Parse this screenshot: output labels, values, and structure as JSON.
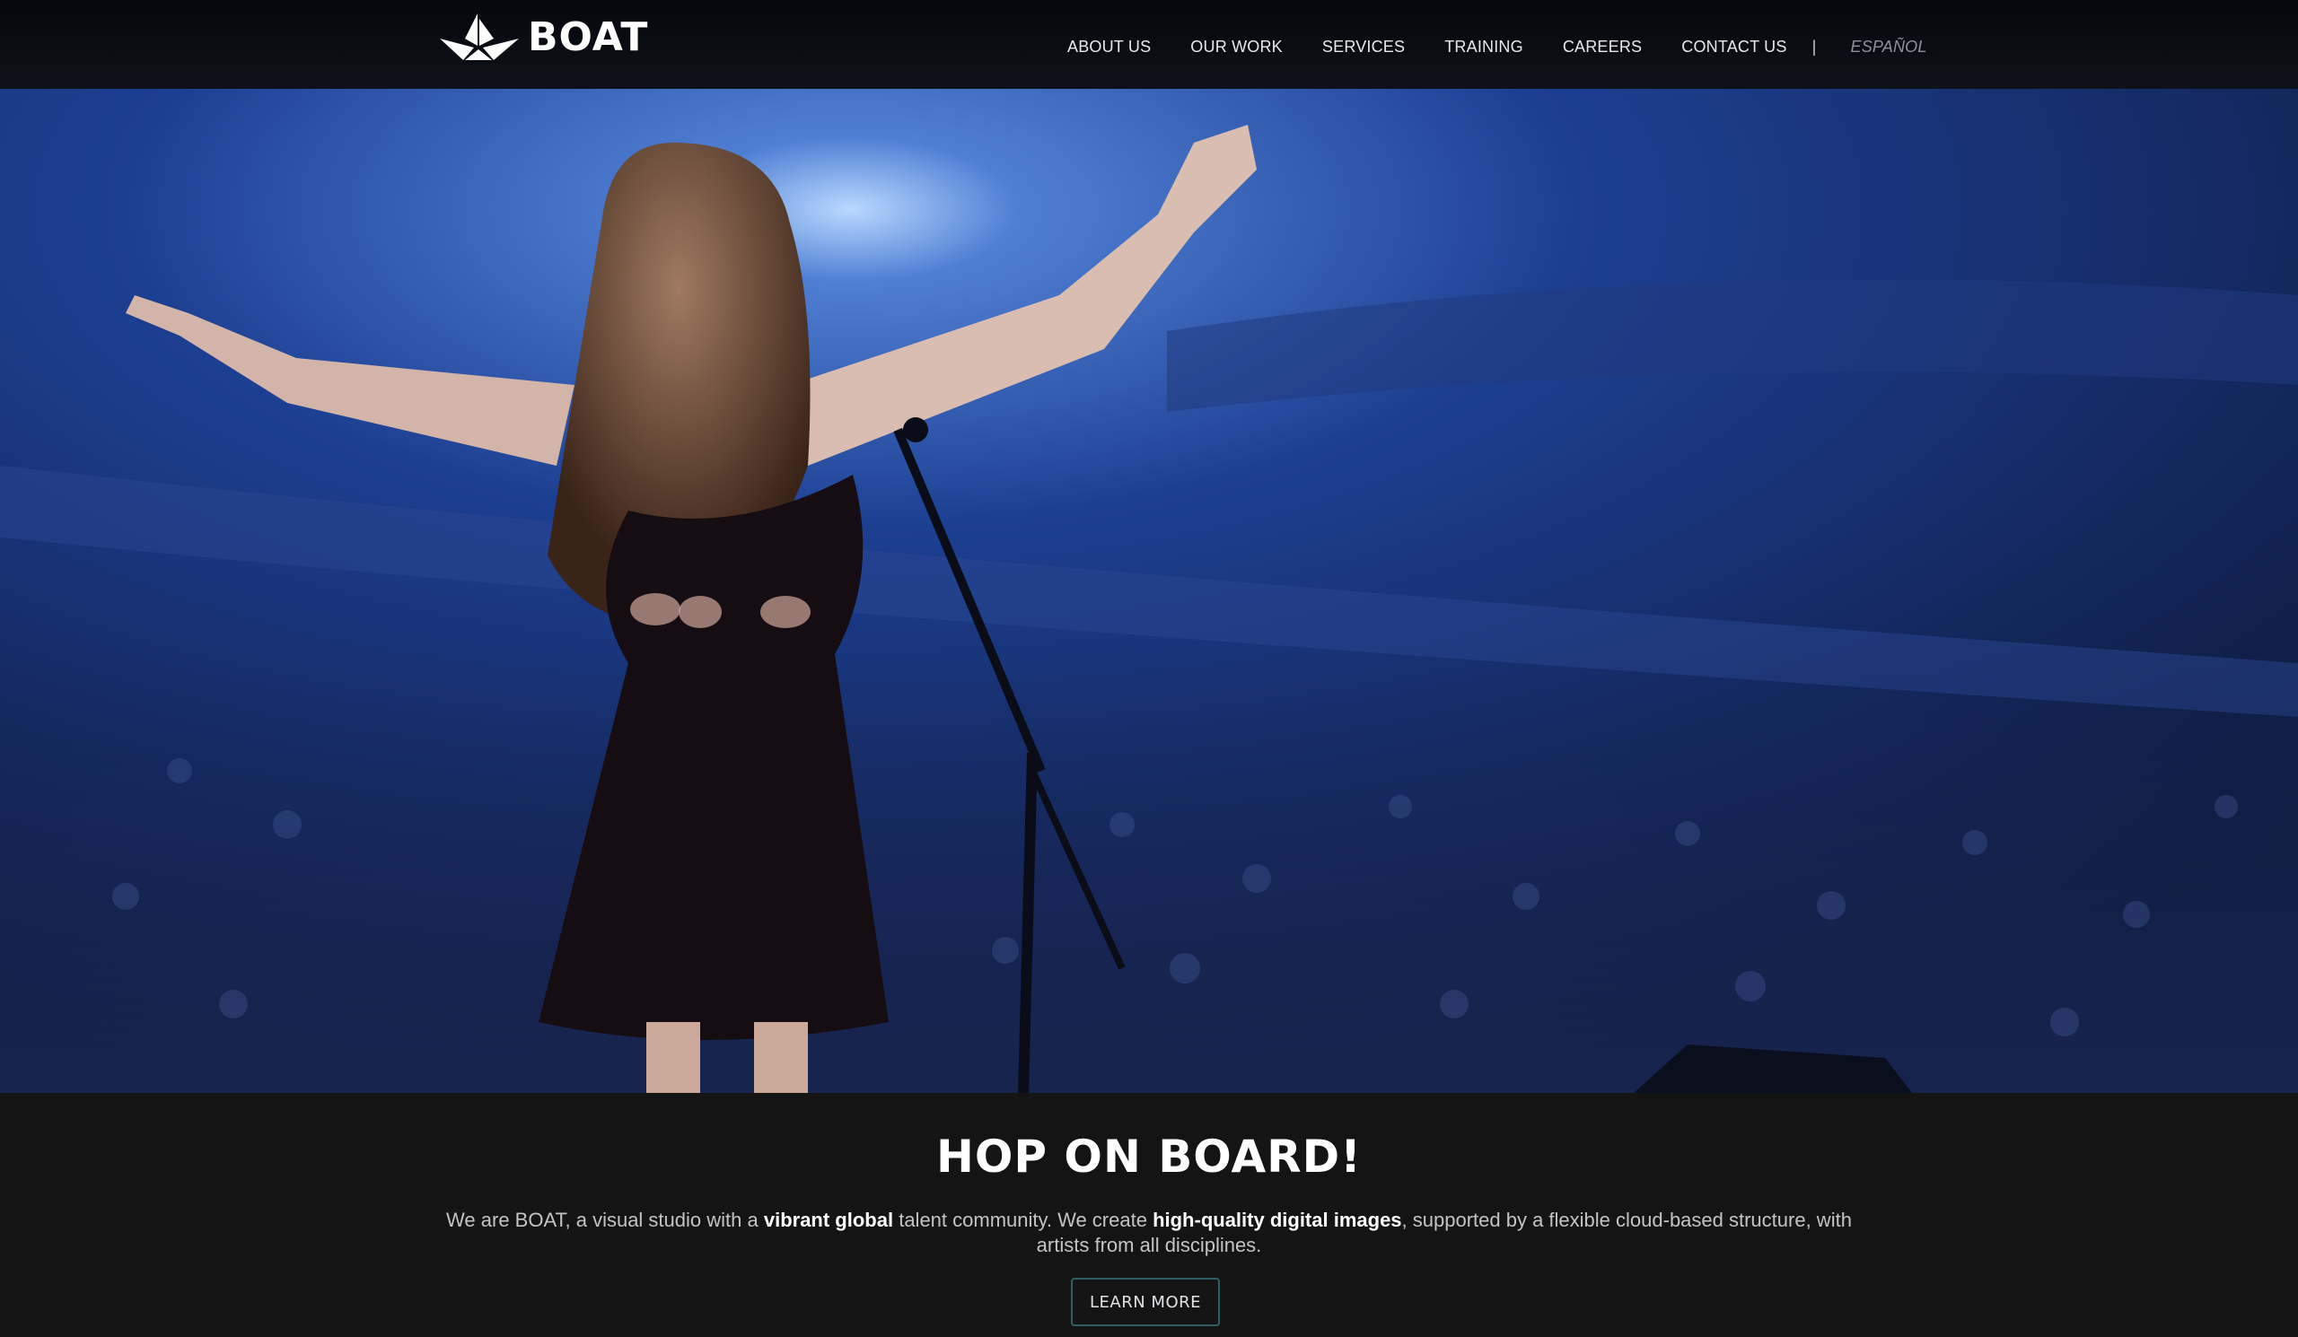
{
  "brand": {
    "name": "BOAT",
    "logo_icon": "paper-boat-icon"
  },
  "nav": {
    "items": [
      "ABOUT US",
      "OUR WORK",
      "SERVICES",
      "TRAINING",
      "CAREERS",
      "CONTACT US"
    ],
    "separator": "|",
    "language": "ESPAÑOL"
  },
  "hero": {
    "image_icon": "concert-singer-photo",
    "slides": 3,
    "active_slide": 2
  },
  "intro": {
    "title": "HOP ON BOARD!",
    "text_1": "We are BOAT, a visual studio with a ",
    "text_2": "vibrant global",
    "text_3": " talent community. We create ",
    "text_4": "high-quality digital images",
    "text_5": ", supported by a flexible cloud-based structure, with artists from all disciplines.",
    "button_label": "LEARN MORE"
  },
  "colors": {
    "header_bg": "#0b0e15",
    "page_bg": "#141414",
    "button_border": "#2f5e63",
    "hero_blue": "#1a3f8f"
  }
}
